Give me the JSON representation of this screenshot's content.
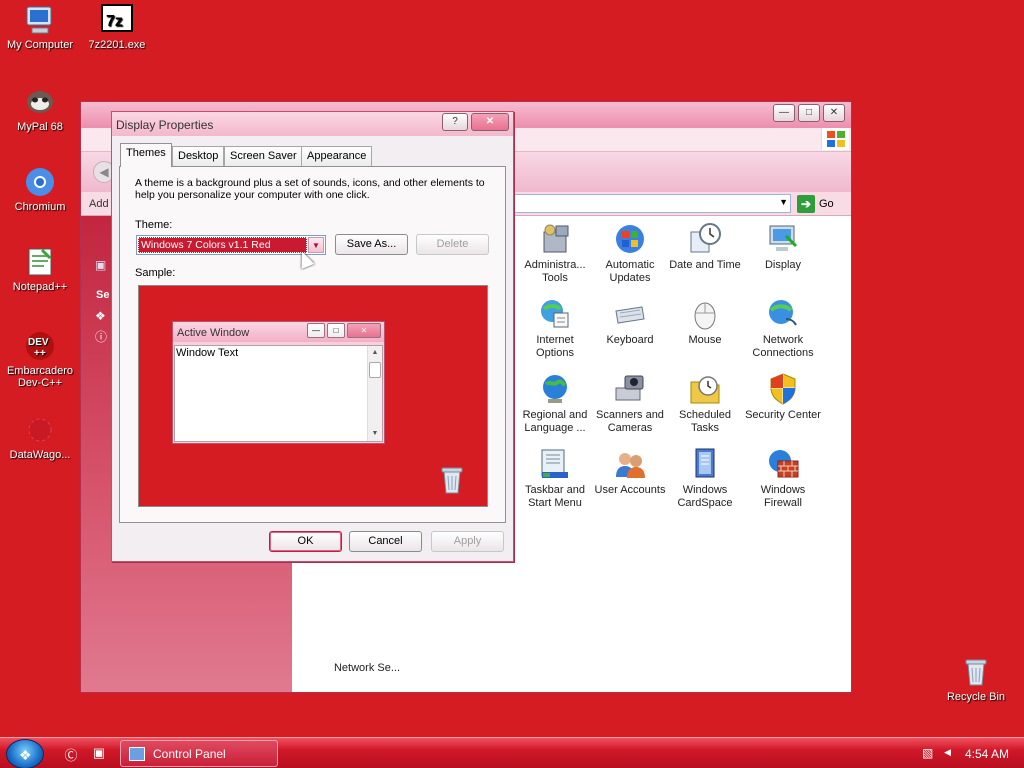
{
  "desktop": {
    "icons": [
      {
        "label": "My Computer"
      },
      {
        "label": "7z2201.exe"
      },
      {
        "label": "MyPal 68"
      },
      {
        "label": "Chromium"
      },
      {
        "label": "Notepad++"
      },
      {
        "label": "Embarcadero Dev-C++"
      },
      {
        "label": "DataWago..."
      },
      {
        "label": "Recycle Bin"
      }
    ]
  },
  "control_panel": {
    "address_label": "Add",
    "go_label": "Go",
    "left_label": "Se",
    "items": [
      {
        "label": "Administra... Tools"
      },
      {
        "label": "Automatic Updates"
      },
      {
        "label": "Date and Time"
      },
      {
        "label": "Display"
      },
      {
        "label": "Internet Options"
      },
      {
        "label": "Keyboard"
      },
      {
        "label": "Mouse"
      },
      {
        "label": "Network Connections"
      },
      {
        "label": "Regional and Language ..."
      },
      {
        "label": "Scanners and Cameras"
      },
      {
        "label": "Scheduled Tasks"
      },
      {
        "label": "Security Center"
      },
      {
        "label": "Taskbar and Start Menu"
      },
      {
        "label": "User Accounts"
      },
      {
        "label": "Windows CardSpace"
      },
      {
        "label": "Windows Firewall"
      },
      {
        "label": "Network Se..."
      }
    ]
  },
  "dialog": {
    "title": "Display Properties",
    "tabs": [
      "Themes",
      "Desktop",
      "Screen Saver",
      "Appearance"
    ],
    "description": "A theme is a background plus a set of sounds, icons, and other elements to help you personalize your computer with one click.",
    "theme_label": "Theme:",
    "theme_value": "Windows 7 Colors v1.1 Red",
    "save_as": "Save As...",
    "delete": "Delete",
    "sample_label": "Sample:",
    "sample_window_title": "Active Window",
    "sample_window_text": "Window Text",
    "ok": "OK",
    "cancel": "Cancel",
    "apply": "Apply"
  },
  "taskbar": {
    "task_label": "Control Panel",
    "clock": "4:54 AM"
  }
}
